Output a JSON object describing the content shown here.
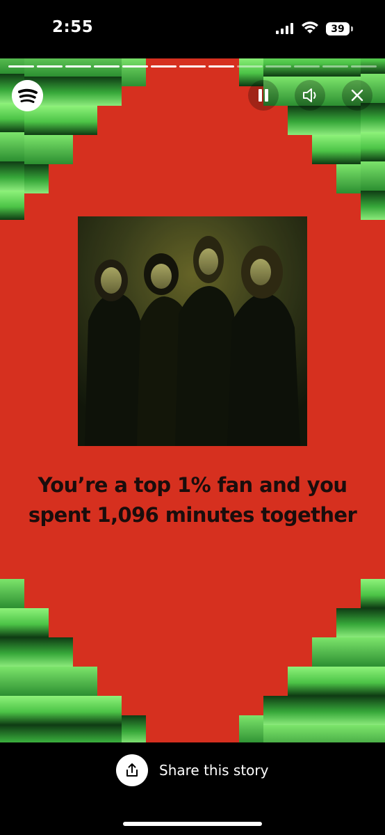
{
  "status_bar": {
    "time": "2:55",
    "battery": "39"
  },
  "story": {
    "background_color": "#D6301F",
    "progress_segments_total": 13,
    "progress_segments_done": 8,
    "headline": "You’re a top 1% fan and you spent 1,096 minutes together"
  },
  "controls": {
    "pause_icon": "pause-icon",
    "volume_icon": "volume-icon",
    "close_icon": "close-icon",
    "logo_icon": "spotify-logo"
  },
  "share": {
    "label": "Share this story",
    "icon": "share-icon"
  }
}
